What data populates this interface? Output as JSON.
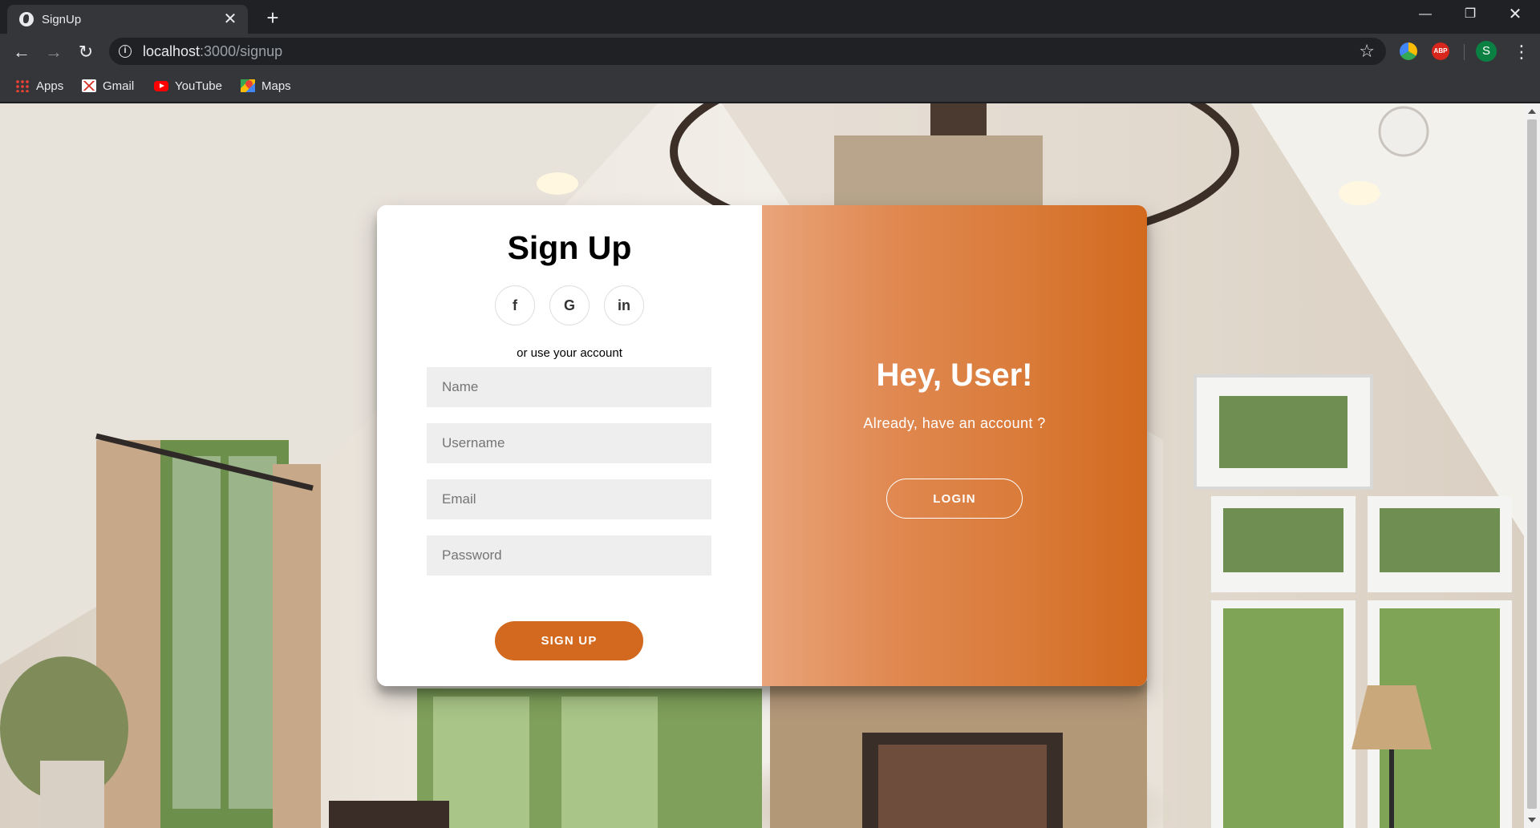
{
  "browser": {
    "tab_title": "SignUp",
    "tab_close": "✕",
    "new_tab": "+",
    "url_host": "localhost",
    "url_path": ":3000/signup",
    "bookmarks": [
      {
        "label": "Apps",
        "icon": "apps-icon"
      },
      {
        "label": "Gmail",
        "icon": "gmail-icon"
      },
      {
        "label": "YouTube",
        "icon": "youtube-icon"
      },
      {
        "label": "Maps",
        "icon": "maps-icon"
      }
    ],
    "profile_initial": "S",
    "extension_abp": "ABP"
  },
  "form": {
    "title": "Sign Up",
    "socials": [
      {
        "glyph": "f",
        "icon": "facebook-icon"
      },
      {
        "glyph": "G",
        "icon": "google-icon"
      },
      {
        "glyph": "in",
        "icon": "linkedin-icon"
      }
    ],
    "alt_text": "or use your account",
    "fields": {
      "name_placeholder": "Name",
      "username_placeholder": "Username",
      "email_placeholder": "Email",
      "password_placeholder": "Password"
    },
    "submit_label": "SIGN UP"
  },
  "overlay": {
    "title": "Hey, User!",
    "text": "Already, have an account ?",
    "login_label": "LOGIN",
    "accent_color": "#d2691e"
  }
}
